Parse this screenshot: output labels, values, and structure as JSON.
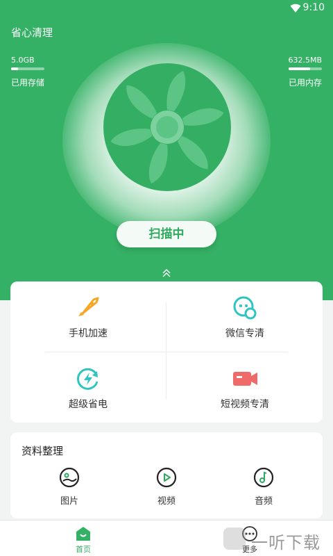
{
  "status_bar": {
    "time": "9:10"
  },
  "app": {
    "title": "省心清理"
  },
  "storage": {
    "value": "5.0GB",
    "label": "已用存储",
    "fraction": 0.2
  },
  "memory": {
    "value": "632.5MB",
    "label": "已用内存",
    "fraction": 0.65
  },
  "scan_button": {
    "label": "扫描中"
  },
  "tools": [
    {
      "label": "手机加速",
      "icon": "rocket-icon"
    },
    {
      "label": "微信专清",
      "icon": "wechat-icon"
    },
    {
      "label": "超级省电",
      "icon": "battery-refresh-icon"
    },
    {
      "label": "短视频专清",
      "icon": "video-camera-icon"
    }
  ],
  "files": {
    "title": "资料整理",
    "items": [
      {
        "label": "图片",
        "icon": "picture-icon"
      },
      {
        "label": "视频",
        "icon": "play-icon"
      },
      {
        "label": "音频",
        "icon": "music-icon"
      }
    ]
  },
  "bottom_nav": [
    {
      "label": "首页",
      "icon": "home-icon"
    },
    {
      "label": "更多",
      "icon": "more-icon"
    }
  ],
  "watermark": {
    "text": "一听下载"
  },
  "colors": {
    "brand_green": "#34b165",
    "tool_orange": "#f5a623",
    "tool_teal": "#2ec4c0",
    "tool_red": "#f06a6a"
  }
}
